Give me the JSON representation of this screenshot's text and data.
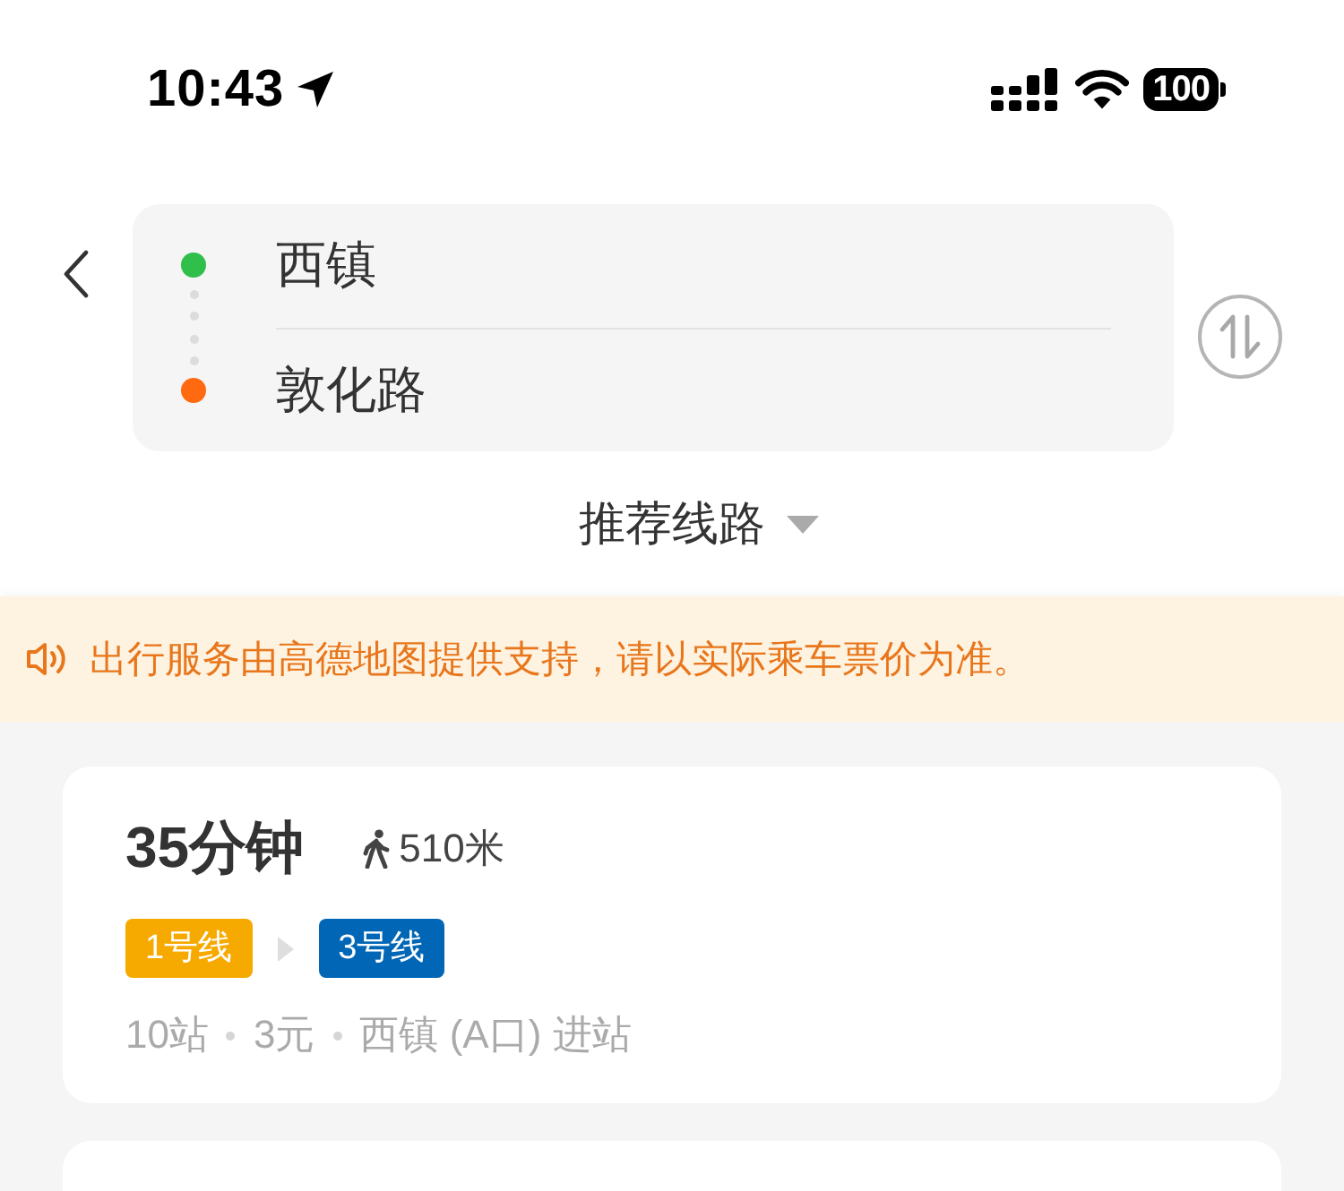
{
  "status_bar": {
    "time": "10:43",
    "battery": "100"
  },
  "stops": [
    {
      "name": "西镇",
      "color": "#2fbf4a"
    },
    {
      "name": "敦化路",
      "color": "#ff6a10"
    }
  ],
  "sort": {
    "label": "推荐线路"
  },
  "notice": {
    "text": "出行服务由高德地图提供支持，请以实际乘车票价为准。"
  },
  "routes": [
    {
      "duration": "35分钟",
      "walk": "510米",
      "lines": [
        {
          "name": "1号线",
          "color": "#f6aa00"
        },
        {
          "name": "3号线",
          "color": "#0066b5"
        }
      ],
      "details": [
        "10站",
        "3元",
        "西镇 (A口) 进站"
      ]
    }
  ]
}
